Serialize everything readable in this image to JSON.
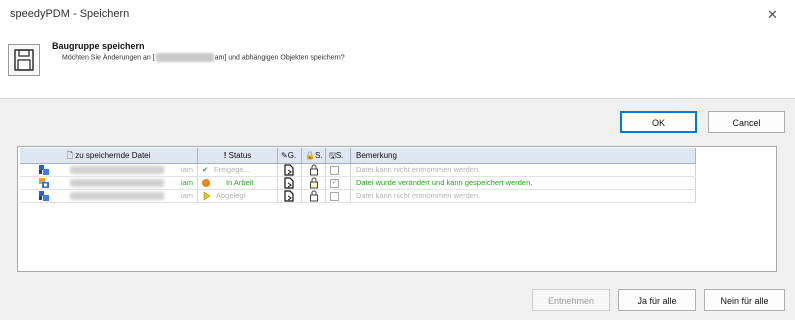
{
  "window": {
    "title": "speedyPDM - Speichern",
    "close": "✕"
  },
  "header": {
    "heading": "Baugruppe speichern",
    "message_before": "Möchten Sie Änderungen an [",
    "message_after": "am] und abhängigen Objekten speichern?"
  },
  "buttons": {
    "ok": "OK",
    "cancel": "Cancel",
    "entnehmen": "Entnehmen",
    "yes_all": "Ja für alle",
    "no_all": "Nein für alle"
  },
  "table": {
    "columns": [
      {
        "icon": "🗋",
        "label": "zu speichernde Datei"
      },
      {
        "icon": "!",
        "label": "Status"
      },
      {
        "icon": "✎",
        "label": "G."
      },
      {
        "icon": "🔒",
        "label": "S."
      },
      {
        "icon": "🖫",
        "label": "S."
      },
      {
        "icon": "",
        "label": "Bemerkung"
      }
    ],
    "rows": [
      {
        "ext": "iam",
        "status": "Freigege...",
        "status_color": "#b4b4b4",
        "status_icon": "check",
        "checked": false,
        "remark": "Datei kann nicht entnommen werden.",
        "remark_color": "#b4b4b4"
      },
      {
        "ext": "iam",
        "status": "In Arbeit",
        "status_color": "#2aa520",
        "status_icon": "orange-dot",
        "checked": true,
        "remark": "Datei wurde verändert und kann gespeichert werden.",
        "remark_color": "#2aa520"
      },
      {
        "ext": "iam",
        "status": "Abgelegt",
        "status_color": "#b4b4b4",
        "status_icon": "yellow-play",
        "checked": false,
        "remark": "Datei kann nicht entnommen werden.",
        "remark_color": "#b4b4b4"
      }
    ]
  },
  "colors": {
    "accent": "#0078d7",
    "ok_green": "#2aa520",
    "grid_header": "#dde6f1"
  }
}
